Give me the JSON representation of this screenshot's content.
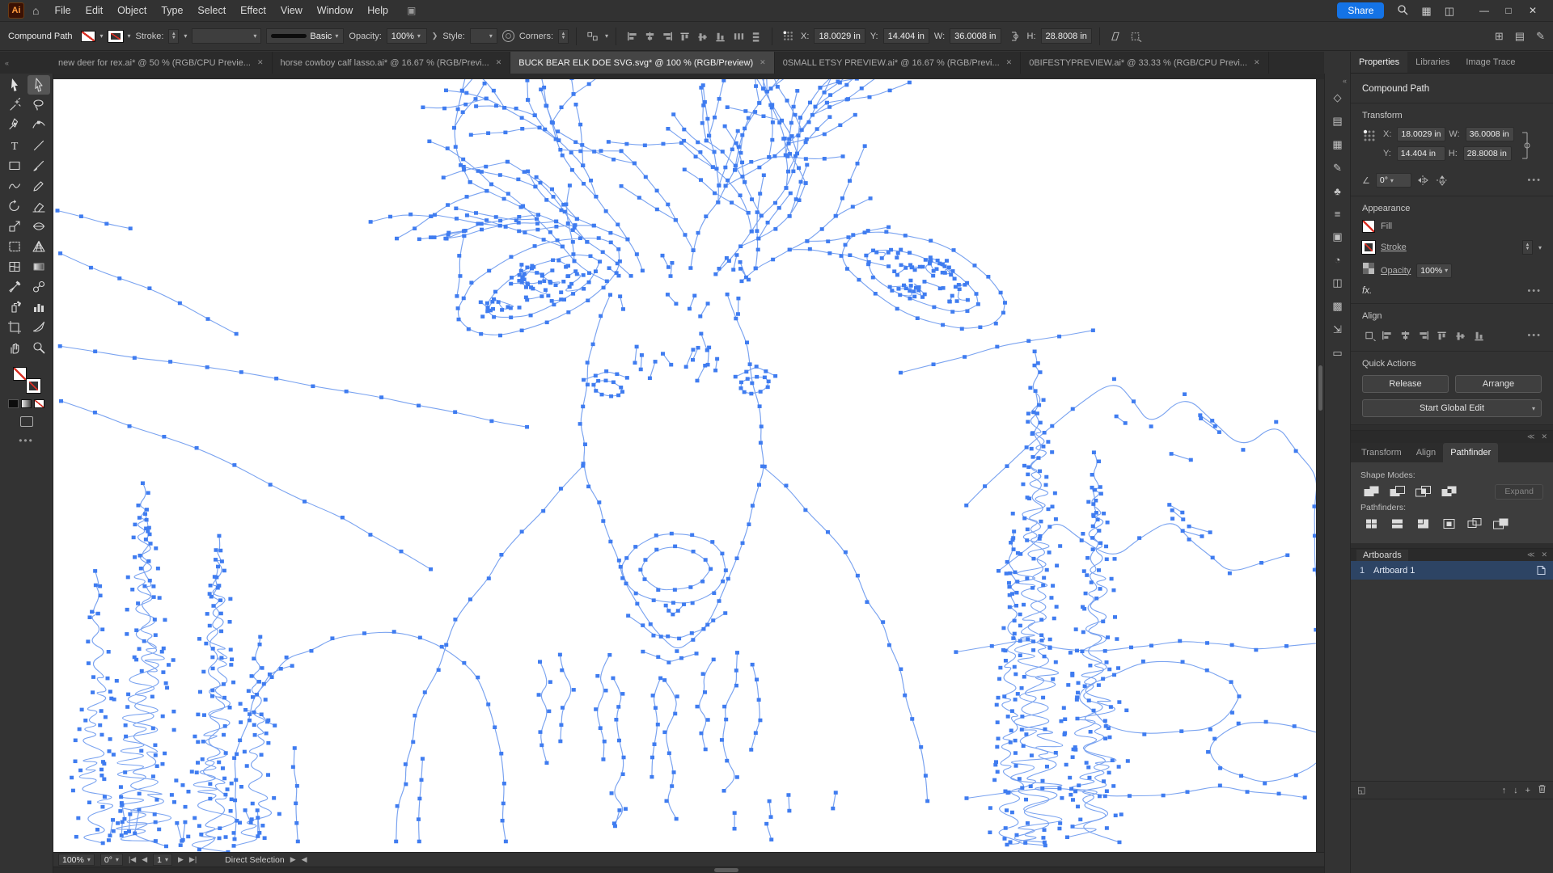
{
  "menubar": {
    "app_icon": "Ai",
    "menus": [
      "File",
      "Edit",
      "Object",
      "Type",
      "Select",
      "Effect",
      "View",
      "Window",
      "Help"
    ],
    "share_label": "Share"
  },
  "control_bar": {
    "selection_type": "Compound Path",
    "stroke_label": "Stroke:",
    "brush_name": "Basic",
    "opacity_label": "Opacity:",
    "opacity_value": "100%",
    "style_label": "Style:",
    "corners_label": "Corners:",
    "x_label": "X:",
    "x_value": "18.0029 in",
    "y_label": "Y:",
    "y_value": "14.404 in",
    "w_label": "W:",
    "w_value": "36.0008 in",
    "h_label": "H:",
    "h_value": "28.8008 in"
  },
  "document_tabs": [
    {
      "title": "new deer for rex.ai* @ 50 % (RGB/CPU Previe...",
      "active": false
    },
    {
      "title": "horse cowboy calf lasso.ai* @ 16.67 % (RGB/Previ...",
      "active": false
    },
    {
      "title": "BUCK BEAR ELK DOE SVG.svg* @ 100 % (RGB/Preview)",
      "active": true
    },
    {
      "title": "0SMALL ETSY PREVIEW.ai* @ 16.67 % (RGB/Previ...",
      "active": false
    },
    {
      "title": "0BIFESTYPREVIEW.ai* @ 33.33 % (RGB/CPU Previ...",
      "active": false
    }
  ],
  "toolbar": {
    "active_tool": "direct-selection",
    "tools": [
      "selection",
      "direct-selection",
      "magic-wand",
      "lasso",
      "pen",
      "curvature",
      "type",
      "line-segment",
      "rectangle",
      "paintbrush",
      "shaper",
      "pencil",
      "rotate",
      "eraser",
      "scale",
      "width",
      "free-transform",
      "perspective-grid",
      "mesh",
      "gradient",
      "eyedropper",
      "blend",
      "symbol-sprayer",
      "column-graph",
      "artboard",
      "slice",
      "hand",
      "zoom"
    ]
  },
  "right_strip": [
    "shapes",
    "document",
    "swatches",
    "brushes",
    "symbols",
    "menu",
    "artboards",
    "color",
    "graphic-styles",
    "layers",
    "export",
    "comments"
  ],
  "panel": {
    "tabs": [
      {
        "label": "Properties",
        "active": true
      },
      {
        "label": "Libraries",
        "active": false
      },
      {
        "label": "Image Trace",
        "active": false
      }
    ],
    "object_type": "Compound Path",
    "transform": {
      "title": "Transform",
      "x_label": "X:",
      "x_value": "18.0029 in",
      "y_label": "Y:",
      "y_value": "14.404 in",
      "w_label": "W:",
      "w_value": "36.0008 in",
      "h_label": "H:",
      "h_value": "28.8008 in",
      "angle_value": "0°"
    },
    "appearance": {
      "title": "Appearance",
      "fill_label": "Fill",
      "stroke_label": "Stroke",
      "opacity_label": "Opacity",
      "opacity_value": "100%",
      "fx_label": "fx."
    },
    "align": {
      "title": "Align"
    },
    "quick_actions": {
      "title": "Quick Actions",
      "release": "Release",
      "arrange": "Arrange",
      "start_global_edit": "Start Global Edit"
    },
    "pathfinder_panel": {
      "tabs": [
        {
          "label": "Transform",
          "active": false
        },
        {
          "label": "Align",
          "active": false
        },
        {
          "label": "Pathfinder",
          "active": true
        }
      ],
      "shape_modes_label": "Shape Modes:",
      "pathfinders_label": "Pathfinders:",
      "expand_label": "Expand"
    },
    "artboards_panel": {
      "title": "Artboards",
      "row": {
        "number": "1",
        "name": "Artboard 1"
      }
    }
  },
  "status_bar": {
    "zoom": "100%",
    "rotation": "0°",
    "artboard_nav": "1",
    "tool_name": "Direct Selection"
  },
  "colors": {
    "share_blue": "#1473e6",
    "anchor_blue": "#3f7cf0",
    "path_blue": "#7aa3f0",
    "artboard_row_blue": "#2d4464"
  }
}
